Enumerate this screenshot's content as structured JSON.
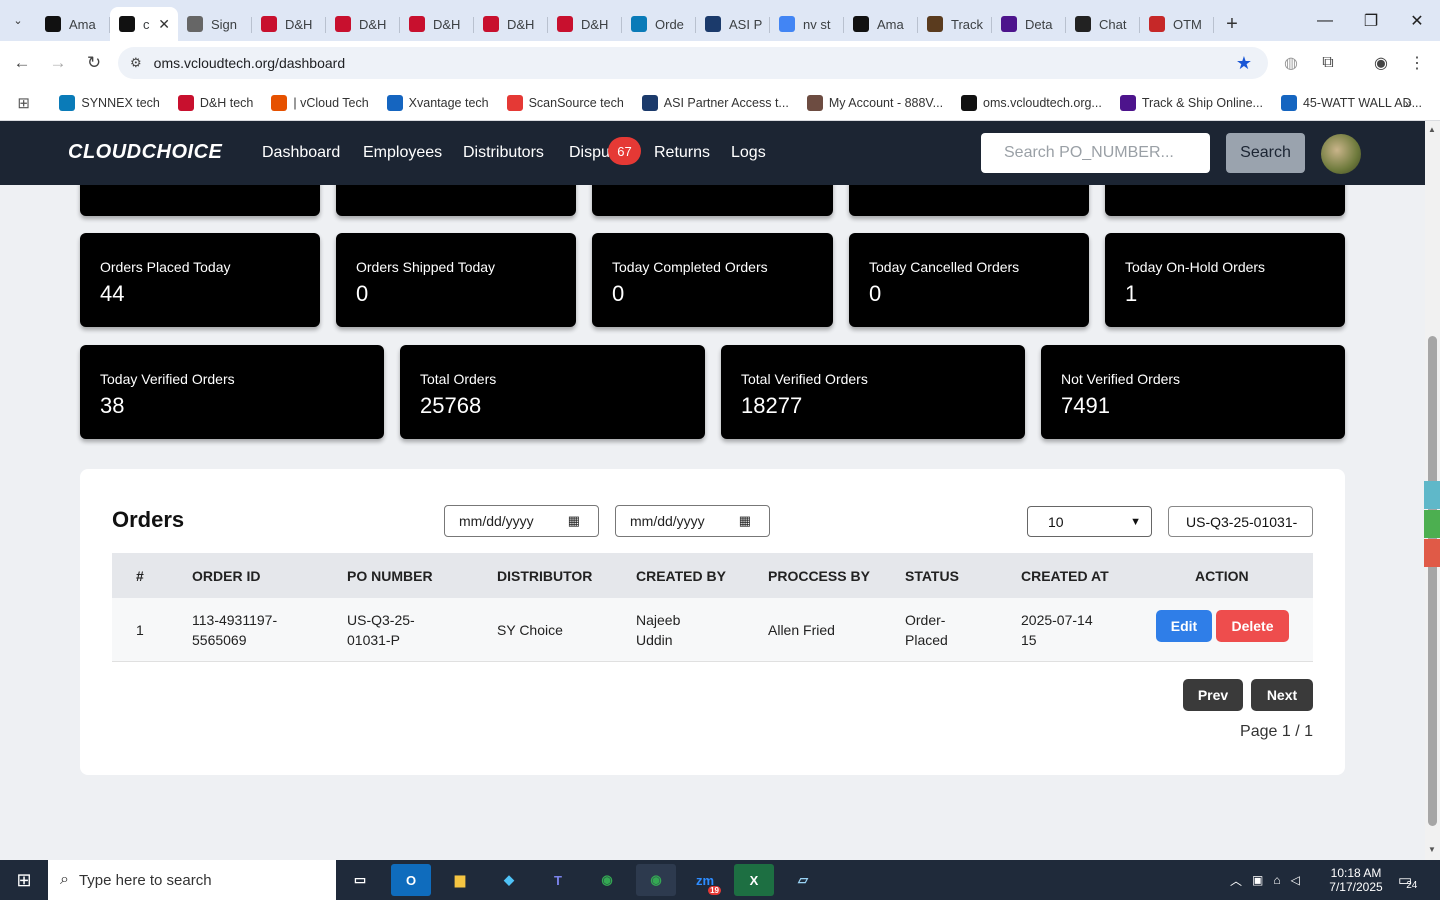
{
  "browser": {
    "tabs": [
      {
        "label": "Ama",
        "favicon": "amazon",
        "color": "#111"
      },
      {
        "label": "c",
        "favicon": "vcloud-oms",
        "color": "#111",
        "active": true
      },
      {
        "label": "Sign",
        "favicon": "globe",
        "color": "#666"
      },
      {
        "label": "D&H",
        "favicon": "dh",
        "color": "#c8102e"
      },
      {
        "label": "D&H",
        "favicon": "dh",
        "color": "#c8102e"
      },
      {
        "label": "D&H",
        "favicon": "dh",
        "color": "#c8102e"
      },
      {
        "label": "D&H",
        "favicon": "dh",
        "color": "#c8102e"
      },
      {
        "label": "D&H",
        "favicon": "dh",
        "color": "#c8102e"
      },
      {
        "label": "Orde",
        "favicon": "ec",
        "color": "#0a7bb8"
      },
      {
        "label": "ASI P",
        "favicon": "asi",
        "color": "#1b3a6b"
      },
      {
        "label": "nv st",
        "favicon": "google",
        "color": "#4285f4"
      },
      {
        "label": "Ama",
        "favicon": "amazon",
        "color": "#111"
      },
      {
        "label": "Track",
        "favicon": "ups",
        "color": "#5a3b1e"
      },
      {
        "label": "Deta",
        "favicon": "fedex",
        "color": "#4d148c"
      },
      {
        "label": "Chat",
        "favicon": "openai",
        "color": "#222"
      },
      {
        "label": "OTM",
        "favicon": "otm",
        "color": "#c62828"
      }
    ],
    "url": "oms.vcloudtech.org/dashboard",
    "bookmarks": [
      {
        "label": "SYNNEX tech",
        "favicon": "ec",
        "color": "#0a7bb8"
      },
      {
        "label": "D&H tech",
        "favicon": "dh",
        "color": "#c8102e"
      },
      {
        "label": "| vCloud Tech",
        "favicon": "vcloud",
        "color": "#e65100"
      },
      {
        "label": "Xvantage tech",
        "favicon": "xvantage",
        "color": "#1565c0"
      },
      {
        "label": "ScanSource tech",
        "favicon": "scansource",
        "color": "#e53935"
      },
      {
        "label": "ASI Partner Access t...",
        "favicon": "asi",
        "color": "#1b3a6b"
      },
      {
        "label": "My Account - 888V...",
        "favicon": "888v",
        "color": "#6d4c41"
      },
      {
        "label": "oms.vcloudtech.org...",
        "favicon": "vcloud-oms",
        "color": "#111"
      },
      {
        "label": "Track & Ship Online...",
        "favicon": "fedex",
        "color": "#4d148c"
      },
      {
        "label": "45-WATT WALL AD...",
        "favicon": "xvantage",
        "color": "#1565c0"
      }
    ]
  },
  "app": {
    "logo": "CLOUDCHOICE",
    "nav": [
      "Dashboard",
      "Employees",
      "Distributors",
      "Dispu",
      "Returns",
      "Logs"
    ],
    "disputes_badge": "67",
    "search_placeholder": "Search PO_NUMBER...",
    "search_button": "Search"
  },
  "stats_row1": [
    {
      "label": "Orders Placed Today",
      "value": "44"
    },
    {
      "label": "Orders Shipped Today",
      "value": "0"
    },
    {
      "label": "Today Completed Orders",
      "value": "0"
    },
    {
      "label": "Today Cancelled Orders",
      "value": "0"
    },
    {
      "label": "Today On-Hold Orders",
      "value": "1"
    }
  ],
  "stats_row2": [
    {
      "label": "Today Verified Orders",
      "value": "38"
    },
    {
      "label": "Total Orders",
      "value": "25768"
    },
    {
      "label": "Total Verified Orders",
      "value": "18277"
    },
    {
      "label": "Not Verified Orders",
      "value": "7491"
    }
  ],
  "orders": {
    "title": "Orders",
    "date_from_placeholder": "mm/dd/yyyy",
    "date_to_placeholder": "mm/dd/yyyy",
    "page_size": "10",
    "po_filter_value": "US-Q3-25-01031-",
    "columns": [
      "#",
      "ORDER ID",
      "PO NUMBER",
      "DISTRIBUTOR",
      "CREATED BY",
      "PROCCESS BY",
      "STATUS",
      "CREATED AT",
      "ACTION"
    ],
    "rows": [
      {
        "num": "1",
        "order_id_1": "113-4931197-",
        "order_id_2": "5565069",
        "po_1": "US-Q3-25-",
        "po_2": "01031-P",
        "distributor": "SY Choice",
        "created_by_1": "Najeeb",
        "created_by_2": "Uddin",
        "processed_by": "Allen Fried",
        "status_1": "Order-",
        "status_2": "Placed",
        "created_at_1": "2025-07-14",
        "created_at_2": "15"
      }
    ],
    "edit_label": "Edit",
    "delete_label": "Delete",
    "prev_label": "Prev",
    "next_label": "Next",
    "page_info": "Page 1 / 1"
  },
  "taskbar": {
    "search_placeholder": "Type here to search",
    "time": "10:18 AM",
    "date": "7/17/2025",
    "notification_count": "24",
    "zoom_badge": "19"
  },
  "colors": {
    "header_bg": "#1c2533",
    "card_bg": "#000000",
    "edit": "#2f7ee8",
    "delete": "#ee4d4d",
    "pager": "#3a3a3a",
    "badge": "#e53935"
  }
}
